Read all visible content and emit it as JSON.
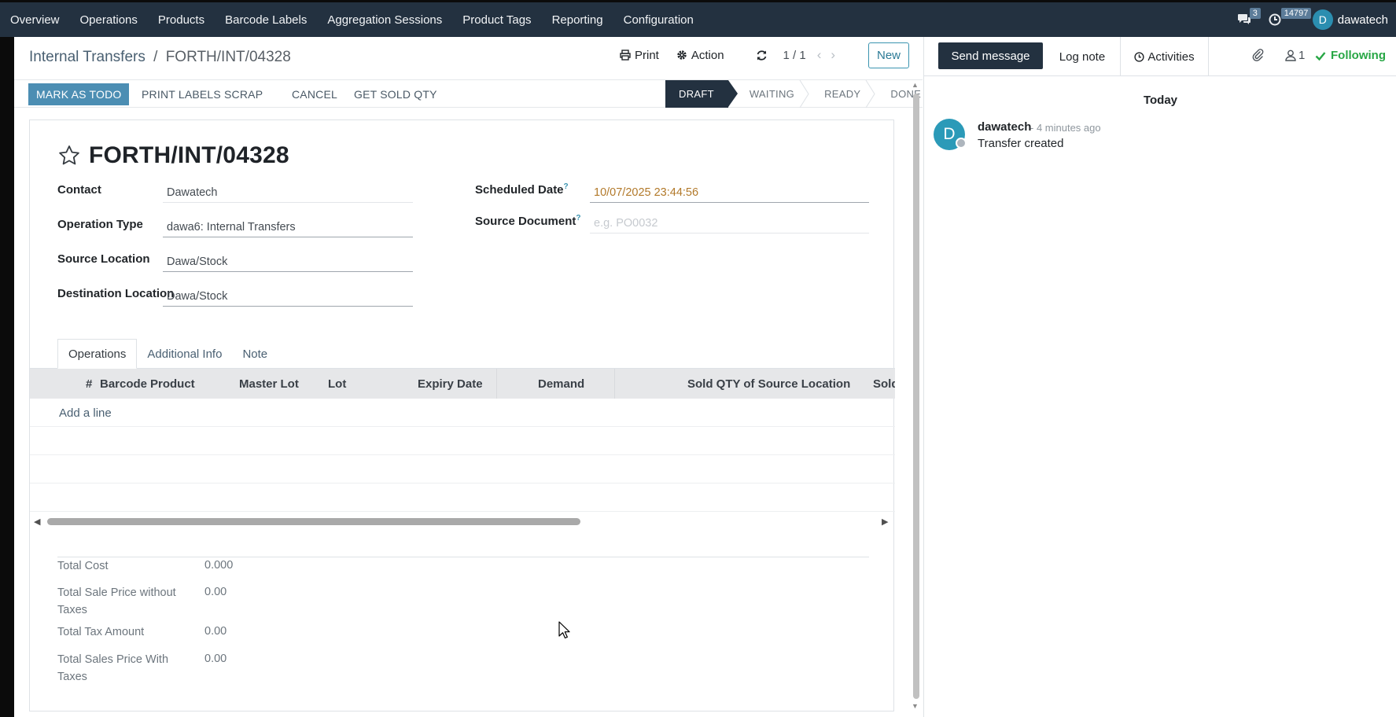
{
  "navbar": {
    "menu": [
      "Overview",
      "Operations",
      "Products",
      "Barcode Labels",
      "Aggregation Sessions",
      "Product Tags",
      "Reporting",
      "Configuration"
    ],
    "messages_count": "3",
    "activities_count": "14797",
    "user_initial": "D",
    "user_name": "dawatech"
  },
  "control_panel": {
    "breadcrumb_parent": "Internal Transfers",
    "breadcrumb_sep": "/",
    "breadcrumb_current": "FORTH/INT/04328",
    "print_label": "Print",
    "action_label": "Action",
    "pager": "1 / 1",
    "new_label": "New"
  },
  "status_buttons": {
    "mark_todo": "MARK AS TODO",
    "print_labels": "PRINT LABELS",
    "scrap": "SCRAP",
    "cancel": "CANCEL",
    "get_sold_qty": "GET SOLD QTY"
  },
  "stages": [
    "DRAFT",
    "WAITING",
    "READY",
    "DONE"
  ],
  "record": {
    "title": "FORTH/INT/04328",
    "contact_label": "Contact",
    "contact_value": "Dawatech",
    "operation_type_label": "Operation Type",
    "operation_type_value": "dawa6: Internal Transfers",
    "source_location_label": "Source Location",
    "source_location_value": "Dawa/Stock",
    "destination_location_label": "Destination Location",
    "destination_location_value": "Dawa/Stock",
    "scheduled_date_label": "Scheduled Date",
    "scheduled_date_value": "10/07/2025 23:44:56",
    "source_document_label": "Source Document",
    "source_document_placeholder": "e.g. PO0032",
    "help_mark": "?"
  },
  "tabs": [
    "Operations",
    "Additional Info",
    "Note"
  ],
  "table": {
    "columns": [
      "#",
      "Barcode",
      "Product",
      "Master Lot",
      "Lot",
      "Expiry Date",
      "Demand",
      "Sold QTY of Source Location",
      "Sold"
    ],
    "add_line": "Add a line"
  },
  "totals": [
    {
      "label": "Total Cost",
      "value": "0.000"
    },
    {
      "label": "Total Sale Price without Taxes",
      "value": "0.00"
    },
    {
      "label": "Total Tax Amount",
      "value": "0.00"
    },
    {
      "label": "Total Sales Price With Taxes",
      "value": "0.00"
    }
  ],
  "chatter": {
    "send_message": "Send message",
    "log_note": "Log note",
    "activities": "Activities",
    "followers_count": "1",
    "following": "Following",
    "date_separator": "Today",
    "message": {
      "avatar_initial": "D",
      "author": "dawatech",
      "time": "- 4 minutes ago",
      "body": "Transfer created"
    }
  },
  "colors": {
    "navbar_bg": "#233140",
    "primary_button": "#4c8eb3",
    "active_stage": "#233140",
    "following_green": "#28a745",
    "date_value": "#b2792a"
  }
}
